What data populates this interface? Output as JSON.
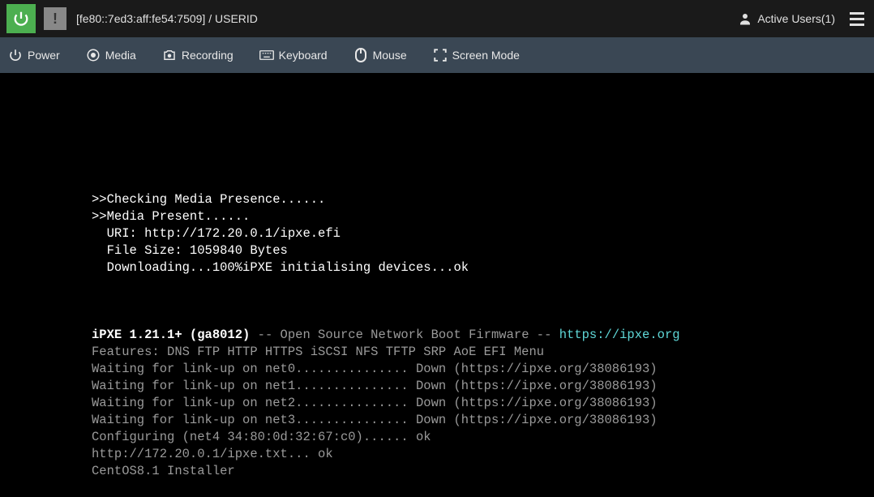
{
  "header": {
    "title": "[fe80::7ed3:aff:fe54:7509] / USERID",
    "active_users_label": "Active Users(1)"
  },
  "toolbar": {
    "power": "Power",
    "media": "Media",
    "recording": "Recording",
    "keyboard": "Keyboard",
    "mouse": "Mouse",
    "screen_mode": "Screen Mode"
  },
  "console": {
    "l1": ">>Checking Media Presence......",
    "l2": ">>Media Present......",
    "l3": "  URI: http://172.20.0.1/ipxe.efi",
    "l4": "  File Size: 1059840 Bytes",
    "l5": "  Downloading...100%iPXE initialising devices...ok",
    "blank": " ",
    "ipxe_prefix": "iPXE 1.21.1+ (ga8012)",
    "ipxe_mid": " -- Open Source Network Boot Firmware -- ",
    "ipxe_url": "https://ipxe.org",
    "features": "Features: DNS FTP HTTP HTTPS iSCSI NFS TFTP SRP AoE EFI Menu",
    "net0": "Waiting for link-up on net0............... Down (https://ipxe.org/38086193)",
    "net1": "Waiting for link-up on net1............... Down (https://ipxe.org/38086193)",
    "net2": "Waiting for link-up on net2............... Down (https://ipxe.org/38086193)",
    "net3": "Waiting for link-up on net3............... Down (https://ipxe.org/38086193)",
    "cfg": "Configuring (net4 34:80:0d:32:67:c0)...... ok",
    "txt": "http://172.20.0.1/ipxe.txt... ok",
    "installer": "CentOS8.1 Installer"
  }
}
